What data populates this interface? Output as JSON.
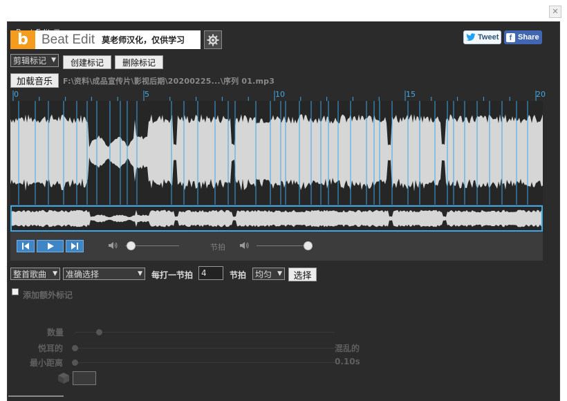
{
  "panel": {
    "tab_title": "Beat Edit",
    "menu_icon": "hamburger-icon"
  },
  "header": {
    "logo_letter": "b",
    "logo_title": "Beat Edit",
    "logo_subtitle": "莫老师汉化，仅供学习",
    "gear_icon": "gear-icon",
    "tweet_label": "Tweet",
    "share_label": "Share"
  },
  "toolbar": {
    "marker_dropdown": "剪辑标记",
    "create_marker": "创建标记",
    "delete_marker": "删除标记",
    "load_music": "加载音乐",
    "file_path": "F:\\资料\\成品宣传片\\影视后期\\20200225...\\序列 01.mp3"
  },
  "timeline": {
    "ruler_labels": [
      "0",
      "5",
      "10",
      "15",
      "20"
    ],
    "accent_color": "#3ea7e5"
  },
  "transport": {
    "prev_icon": "skip-back-icon",
    "play_icon": "play-icon",
    "next_icon": "skip-forward-icon",
    "volume_icon": "speaker-icon",
    "volume_level": 0.1,
    "beat_label": "节拍",
    "beat_volume_level": 1.0
  },
  "controls": {
    "scope_dropdown": "整首歌曲",
    "mode_dropdown": "准确选择",
    "per_beat_label": "每打一节拍",
    "beat_count": "4",
    "beat_unit": "节拍",
    "distribution_dropdown": "均匀",
    "select_button": "选择"
  },
  "extra": {
    "add_extra_markers": "添加额外标记",
    "quantity_label": "数量",
    "pleasant_label": "悦耳的",
    "chaotic_label": "混乱的",
    "min_distance_label": "最小距离",
    "min_distance_value": "0.10s",
    "cube_icon": "cube-icon"
  }
}
